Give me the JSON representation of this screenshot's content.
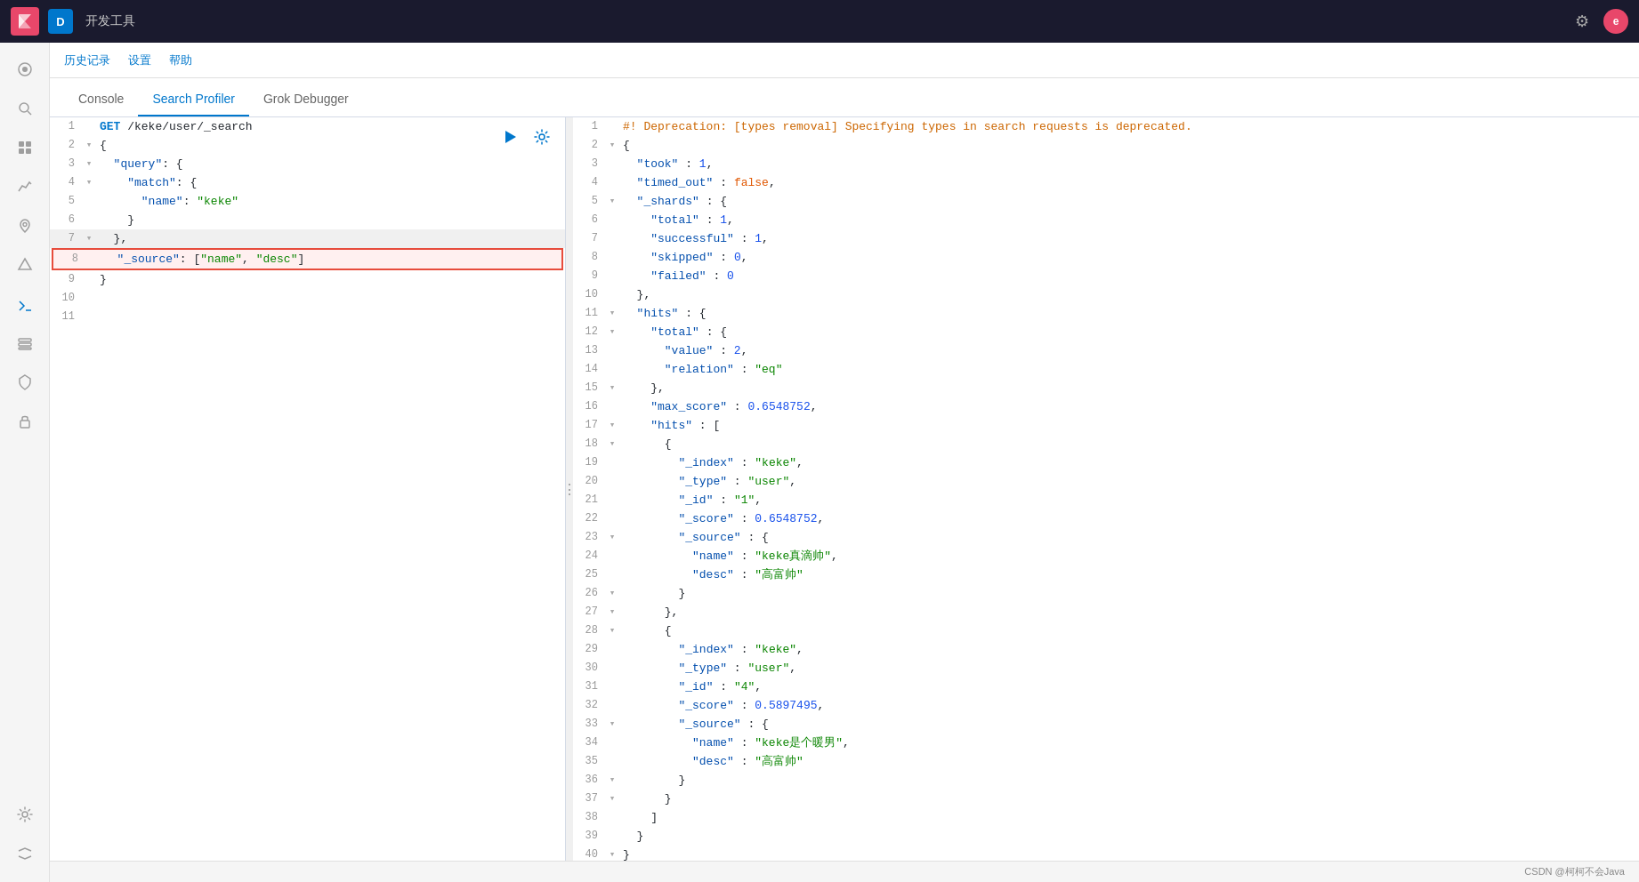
{
  "topbar": {
    "logo_letter": "D",
    "app_name": "开发工具",
    "gear_icon": "⚙",
    "user_letter": "e"
  },
  "secondary_nav": {
    "items": [
      "历史记录",
      "设置",
      "帮助"
    ]
  },
  "tabs": [
    {
      "id": "console",
      "label": "Console",
      "active": false
    },
    {
      "id": "search-profiler",
      "label": "Search Profiler",
      "active": true
    },
    {
      "id": "grok-debugger",
      "label": "Grok Debugger",
      "active": false
    }
  ],
  "sidebar": {
    "icons": [
      {
        "id": "home",
        "symbol": "⊙",
        "active": false
      },
      {
        "id": "discover",
        "symbol": "🔍",
        "active": false
      },
      {
        "id": "dashboard",
        "symbol": "▦",
        "active": false
      },
      {
        "id": "visualize",
        "symbol": "📊",
        "active": false
      },
      {
        "id": "maps",
        "symbol": "◉",
        "active": false
      },
      {
        "id": "ml",
        "symbol": "✦",
        "active": false
      },
      {
        "id": "dev-tools",
        "symbol": "⚒",
        "active": true
      },
      {
        "id": "stack-monitoring",
        "symbol": "📈",
        "active": false
      },
      {
        "id": "fleet",
        "symbol": "🛡",
        "active": false
      },
      {
        "id": "security",
        "symbol": "🔒",
        "active": false
      },
      {
        "id": "settings-bottom",
        "symbol": "⚙",
        "active": false
      }
    ],
    "bottom_icons": [
      {
        "id": "collapse",
        "symbol": "⇔"
      }
    ]
  },
  "editor": {
    "request_lines": [
      {
        "num": 1,
        "fold": "",
        "content": "GET /keke/user/_search",
        "class": "normal",
        "method": true
      },
      {
        "num": 2,
        "fold": "▾",
        "content": "{",
        "class": "normal"
      },
      {
        "num": 3,
        "fold": "▾",
        "content": "  \"query\": {",
        "class": "normal"
      },
      {
        "num": 4,
        "fold": "▾",
        "content": "    \"match\": {",
        "class": "normal"
      },
      {
        "num": 5,
        "fold": "",
        "content": "      \"name\": \"keke\"",
        "class": "normal"
      },
      {
        "num": 6,
        "fold": "",
        "content": "    }",
        "class": "normal"
      },
      {
        "num": 7,
        "fold": "",
        "content": "  },",
        "class": "highlighted"
      },
      {
        "num": 8,
        "fold": "",
        "content": "  \"_source\": [\"name\", \"desc\"]",
        "class": "selected"
      },
      {
        "num": 9,
        "fold": "",
        "content": "}",
        "class": "normal"
      },
      {
        "num": 10,
        "fold": "",
        "content": "",
        "class": "normal"
      },
      {
        "num": 11,
        "fold": "",
        "content": "",
        "class": "normal"
      }
    ]
  },
  "response": {
    "lines": [
      {
        "num": 1,
        "fold": "",
        "content": "#! Deprecation: [types removal] Specifying types in search requests is deprecated.",
        "type": "comment"
      },
      {
        "num": 2,
        "fold": "▾",
        "content": "{",
        "type": "punct"
      },
      {
        "num": 3,
        "fold": "",
        "content": "  \"took\" : 1,",
        "type": "mixed"
      },
      {
        "num": 4,
        "fold": "",
        "content": "  \"timed_out\" : false,",
        "type": "mixed"
      },
      {
        "num": 5,
        "fold": "▾",
        "content": "  \"_shards\" : {",
        "type": "mixed"
      },
      {
        "num": 6,
        "fold": "",
        "content": "    \"total\" : 1,",
        "type": "mixed"
      },
      {
        "num": 7,
        "fold": "",
        "content": "    \"successful\" : 1,",
        "type": "mixed"
      },
      {
        "num": 8,
        "fold": "",
        "content": "    \"skipped\" : 0,",
        "type": "mixed"
      },
      {
        "num": 9,
        "fold": "",
        "content": "    \"failed\" : 0",
        "type": "mixed"
      },
      {
        "num": 10,
        "fold": "",
        "content": "  },",
        "type": "punct"
      },
      {
        "num": 11,
        "fold": "▾",
        "content": "  \"hits\" : {",
        "type": "mixed"
      },
      {
        "num": 12,
        "fold": "▾",
        "content": "    \"total\" : {",
        "type": "mixed"
      },
      {
        "num": 13,
        "fold": "",
        "content": "      \"value\" : 2,",
        "type": "mixed"
      },
      {
        "num": 14,
        "fold": "",
        "content": "      \"relation\" : \"eq\"",
        "type": "mixed"
      },
      {
        "num": 15,
        "fold": "",
        "content": "    },",
        "type": "punct"
      },
      {
        "num": 16,
        "fold": "",
        "content": "    \"max_score\" : 0.6548752,",
        "type": "mixed"
      },
      {
        "num": 17,
        "fold": "▾",
        "content": "    \"hits\" : [",
        "type": "mixed"
      },
      {
        "num": 18,
        "fold": "▾",
        "content": "      {",
        "type": "punct"
      },
      {
        "num": 19,
        "fold": "",
        "content": "        \"_index\" : \"keke\",",
        "type": "mixed"
      },
      {
        "num": 20,
        "fold": "",
        "content": "        \"_type\" : \"user\",",
        "type": "mixed"
      },
      {
        "num": 21,
        "fold": "",
        "content": "        \"_id\" : \"1\",",
        "type": "mixed"
      },
      {
        "num": 22,
        "fold": "",
        "content": "        \"_score\" : 0.6548752,",
        "type": "mixed"
      },
      {
        "num": 23,
        "fold": "▾",
        "content": "        \"_source\" : {",
        "type": "mixed"
      },
      {
        "num": 24,
        "fold": "",
        "content": "          \"name\" : \"keke真滴帅\",",
        "type": "mixed"
      },
      {
        "num": 25,
        "fold": "",
        "content": "          \"desc\" : \"高富帅\"",
        "type": "mixed"
      },
      {
        "num": 26,
        "fold": "",
        "content": "        }",
        "type": "punct"
      },
      {
        "num": 27,
        "fold": "",
        "content": "      },",
        "type": "punct"
      },
      {
        "num": 28,
        "fold": "▾",
        "content": "      {",
        "type": "punct"
      },
      {
        "num": 29,
        "fold": "",
        "content": "        \"_index\" : \"keke\",",
        "type": "mixed"
      },
      {
        "num": 30,
        "fold": "",
        "content": "        \"_type\" : \"user\",",
        "type": "mixed"
      },
      {
        "num": 31,
        "fold": "",
        "content": "        \"_id\" : \"4\",",
        "type": "mixed"
      },
      {
        "num": 32,
        "fold": "",
        "content": "        \"_score\" : 0.5897495,",
        "type": "mixed"
      },
      {
        "num": 33,
        "fold": "▾",
        "content": "        \"_source\" : {",
        "type": "mixed"
      },
      {
        "num": 34,
        "fold": "",
        "content": "          \"name\" : \"keke是个暖男\",",
        "type": "mixed"
      },
      {
        "num": 35,
        "fold": "",
        "content": "          \"desc\" : \"高富帅\"",
        "type": "mixed"
      },
      {
        "num": 36,
        "fold": "",
        "content": "        }",
        "type": "punct"
      },
      {
        "num": 37,
        "fold": "",
        "content": "      }",
        "type": "punct"
      },
      {
        "num": 38,
        "fold": "",
        "content": "    ]",
        "type": "punct"
      },
      {
        "num": 39,
        "fold": "",
        "content": "  }",
        "type": "punct"
      },
      {
        "num": 40,
        "fold": "▾",
        "content": "}",
        "type": "punct"
      }
    ]
  },
  "status_bar": {
    "text": "CSDN @柯柯不会Java"
  }
}
